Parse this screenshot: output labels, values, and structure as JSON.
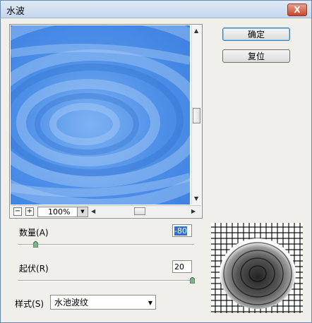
{
  "window": {
    "title": "水波",
    "close_label": "X"
  },
  "buttons": {
    "ok": "确定",
    "reset": "复位"
  },
  "preview": {
    "zoom_out": "−",
    "zoom_in": "+",
    "zoom": "100%"
  },
  "controls": {
    "amount": {
      "label": "数量",
      "key": "(A)",
      "value": "-80",
      "fraction": 0.1
    },
    "ridges": {
      "label": "起伏",
      "key": "(R)",
      "value": "20",
      "fraction": 1.0
    },
    "style": {
      "label": "样式",
      "key": "(S)",
      "value": "水池波纹"
    }
  }
}
